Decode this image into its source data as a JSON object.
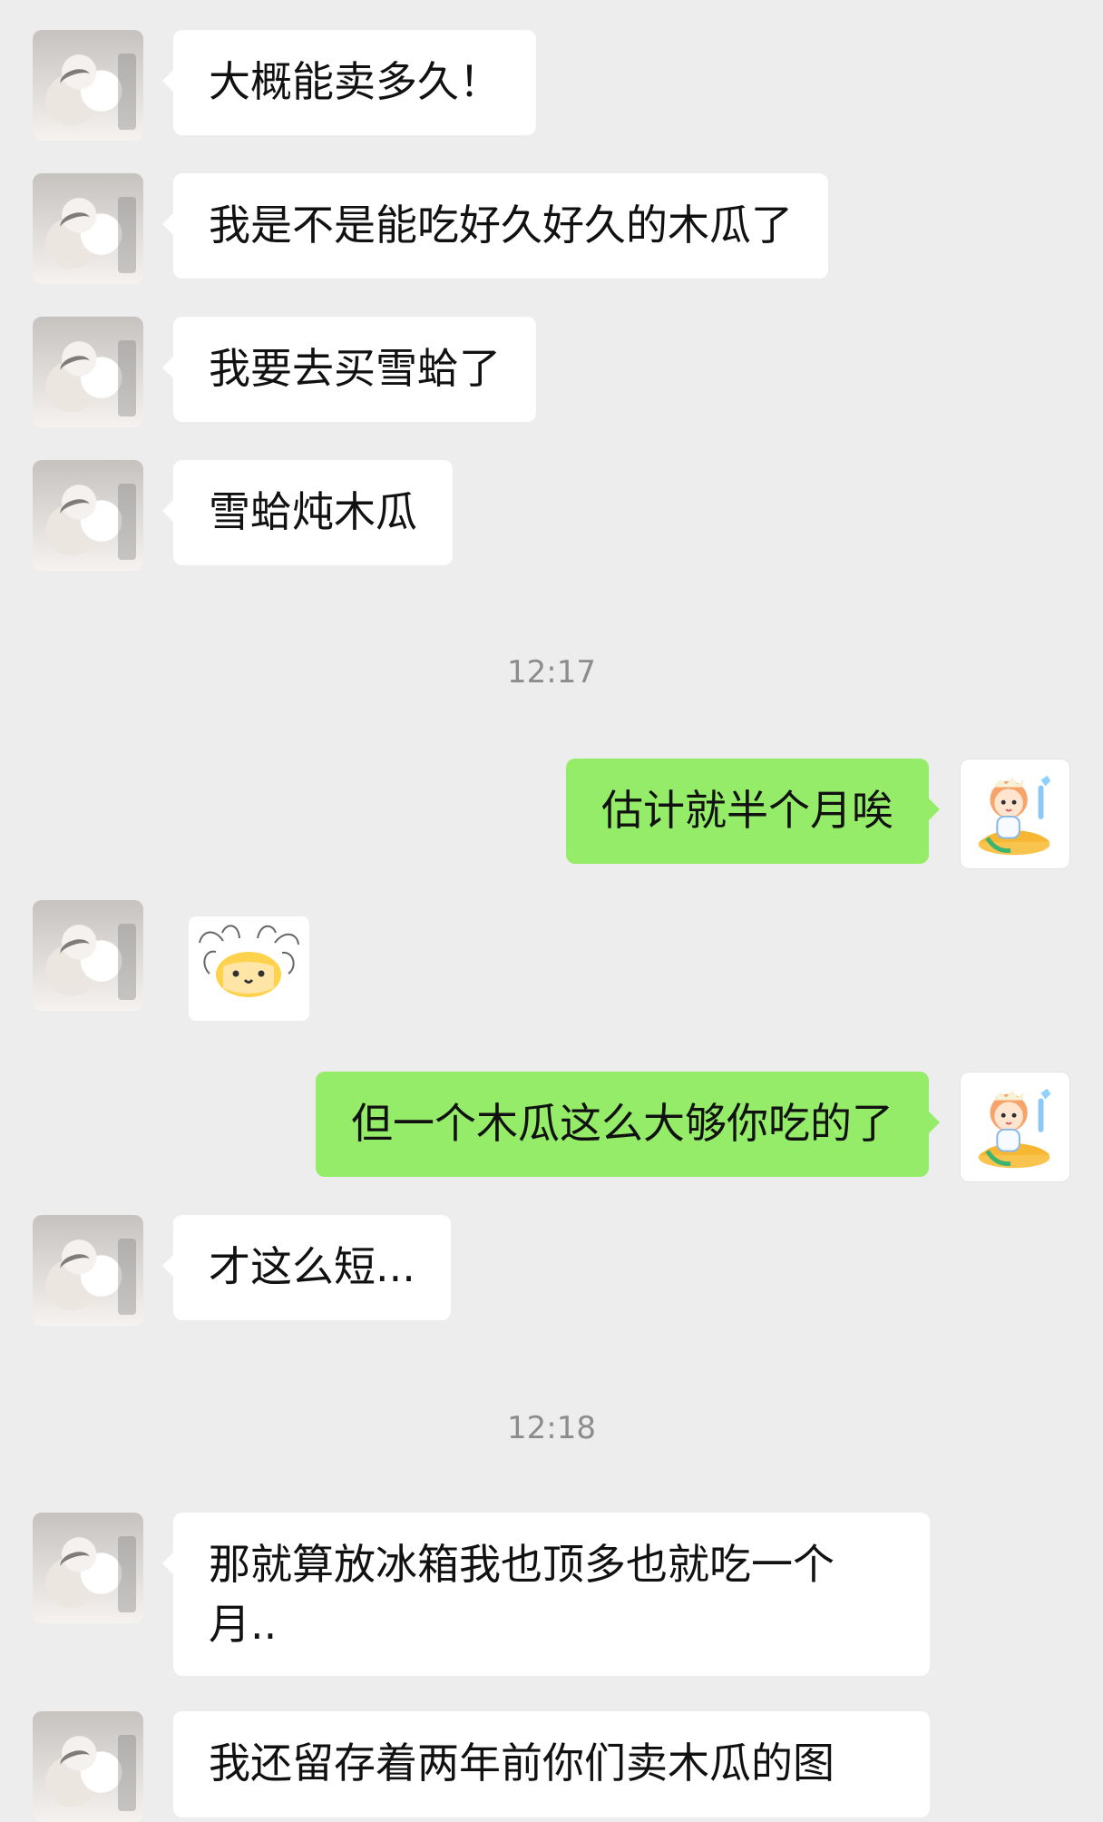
{
  "messages": [
    {
      "side": "left",
      "text": "大概能卖多久！"
    },
    {
      "side": "left",
      "text": "我是不是能吃好久好久的木瓜了"
    },
    {
      "side": "left",
      "text": "我要去买雪蛤了"
    },
    {
      "side": "left",
      "text": "雪蛤炖木瓜"
    },
    {
      "type": "timestamp",
      "text": "12:17"
    },
    {
      "side": "right",
      "text": "估计就半个月唉"
    },
    {
      "side": "left",
      "type": "sticker",
      "icon": "spider-fox-sticker"
    },
    {
      "side": "right",
      "text": "但一个木瓜这么大够你吃的了"
    },
    {
      "side": "left",
      "text": "才这么短..."
    },
    {
      "type": "timestamp",
      "text": "12:18"
    },
    {
      "side": "left",
      "text": "那就算放冰箱我也顶多也就吃一个月.."
    },
    {
      "side": "left",
      "text": "我还留存着两年前你们卖木瓜的图"
    }
  ],
  "colors": {
    "background": "#ededed",
    "incoming_bubble": "#ffffff",
    "outgoing_bubble": "#95ec69",
    "timestamp_text": "#8c8c8c"
  },
  "icons": {
    "incoming_avatar": "cat-avatar-icon",
    "outgoing_avatar": "girl-avatar-icon",
    "sticker": "spider-fox-sticker-icon"
  }
}
